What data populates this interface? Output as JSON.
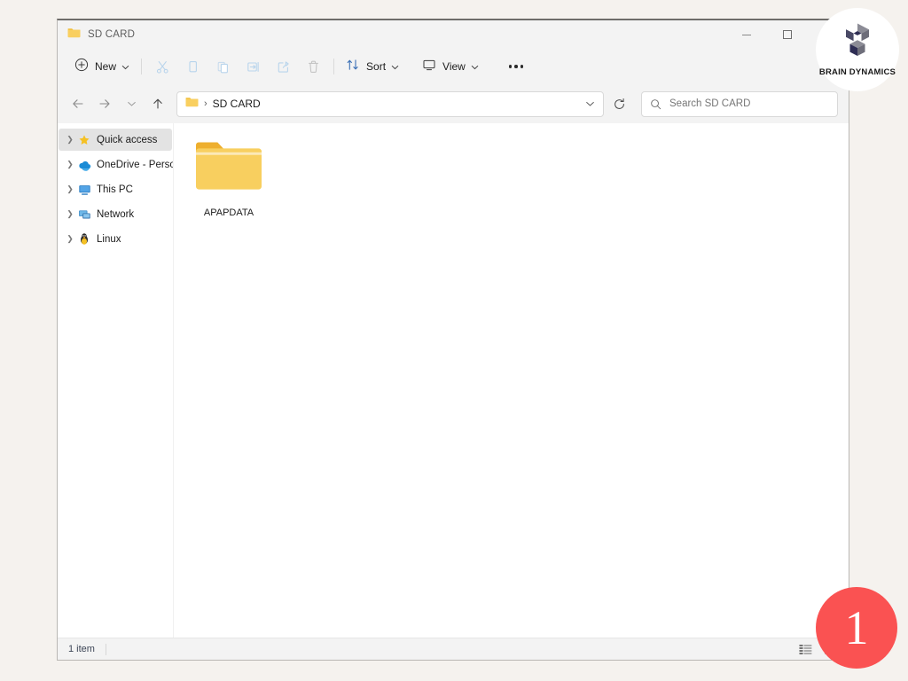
{
  "window": {
    "title": "SD CARD",
    "title_icon": "folder-icon",
    "controls": {
      "minimize": "minimize-icon",
      "maximize": "maximize-icon",
      "close": "close-icon"
    }
  },
  "toolbar": {
    "new_label": "New",
    "new_icon": "plus-circle-icon",
    "caret": "⌄",
    "icons": [
      {
        "name": "cut-icon",
        "title": "Cut"
      },
      {
        "name": "copy-icon",
        "title": "Copy"
      },
      {
        "name": "paste-icon",
        "title": "Paste"
      },
      {
        "name": "rename-icon",
        "title": "Rename"
      },
      {
        "name": "share-icon",
        "title": "Share"
      },
      {
        "name": "delete-icon",
        "title": "Delete"
      }
    ],
    "sort_label": "Sort",
    "sort_icon": "sort-arrows-icon",
    "view_label": "View",
    "view_icon": "monitor-icon",
    "overflow_label": "See more"
  },
  "address": {
    "back_icon": "arrow-left-icon",
    "forward_icon": "arrow-right-icon",
    "recent_icon": "chevron-down-icon",
    "up_icon": "arrow-up-icon",
    "crumb_icon": "folder-icon",
    "crumb_separator": "›",
    "path": "SD CARD",
    "dropdown_icon": "chevron-down-icon",
    "refresh_icon": "refresh-icon"
  },
  "search": {
    "icon": "search-icon",
    "placeholder": "Search SD CARD"
  },
  "sidebar": {
    "items": [
      {
        "label": "Quick access",
        "icon": "star-icon",
        "selected": true
      },
      {
        "label": "OneDrive - Persona",
        "icon": "cloud-icon",
        "selected": false
      },
      {
        "label": "This PC",
        "icon": "monitor-icon",
        "selected": false
      },
      {
        "label": "Network",
        "icon": "network-icon",
        "selected": false
      },
      {
        "label": "Linux",
        "icon": "penguin-icon",
        "selected": false
      }
    ]
  },
  "content": {
    "files": [
      {
        "name": "APAPDATA",
        "icon": "folder-icon",
        "type": "folder"
      }
    ]
  },
  "status": {
    "item_count": "1 item",
    "view_icons": [
      "details-view-icon",
      "large-icons-view-icon"
    ]
  },
  "overlays": {
    "brand_name": "BRAIN DYNAMICS",
    "brand_logo_icon": "brain-dynamics-logo-icon",
    "step_number": "1"
  },
  "colors": {
    "accent_folder": "#f7c648",
    "badge_red": "#fa5252",
    "page_background": "#f5f2ee",
    "chrome": "#f3f3f3",
    "brand_navy": "#2e2d54"
  }
}
